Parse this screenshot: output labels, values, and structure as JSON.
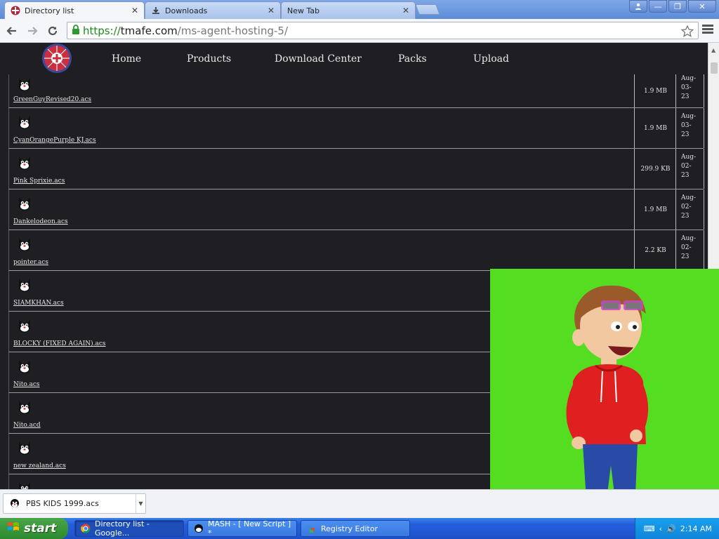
{
  "browser": {
    "tabs": [
      {
        "title": "Directory list",
        "state": "active"
      },
      {
        "title": "Downloads",
        "state": "inactive"
      },
      {
        "title": "New Tab",
        "state": "inactive"
      }
    ],
    "url": {
      "scheme": "https://",
      "host": "tmafe.com",
      "path": "/ms-agent-hosting-5/"
    }
  },
  "site": {
    "nav": [
      {
        "label": "Home"
      },
      {
        "label": "Products"
      },
      {
        "label": "Download Center"
      },
      {
        "label": "Packs"
      },
      {
        "label": "Upload"
      }
    ]
  },
  "files": [
    {
      "name": "GreenGuyRevised20.acs",
      "size": "1.9 MB",
      "date": [
        "Aug-",
        "03-",
        "23"
      ]
    },
    {
      "name": "CyanOrangePurple KJ.acs",
      "size": "1.9 MB",
      "date": [
        "Aug-",
        "03-",
        "23"
      ]
    },
    {
      "name": "Pink Sprixie.acs",
      "size": "299.9 KB",
      "date": [
        "Aug-",
        "02-",
        "23"
      ]
    },
    {
      "name": "Dankelodeon.acs",
      "size": "1.9 MB",
      "date": [
        "Aug-",
        "02-",
        "23"
      ]
    },
    {
      "name": "pointer.acs",
      "size": "2.2 KB",
      "date": [
        "Aug-",
        "02-",
        "23"
      ]
    },
    {
      "name": "SIAMKHAN.acs",
      "size": "",
      "date": [
        "",
        "",
        ""
      ]
    },
    {
      "name": "BLOCKY (FIXED AGAIN).acs",
      "size": "",
      "date": [
        "",
        "",
        ""
      ]
    },
    {
      "name": "Nito.acs",
      "size": "",
      "date": [
        "",
        "",
        ""
      ]
    },
    {
      "name": "Nito.acd",
      "size": "",
      "date": [
        "",
        "",
        ""
      ]
    },
    {
      "name": "new zealand.acs",
      "size": "",
      "date": [
        "",
        "",
        ""
      ]
    }
  ],
  "download_bar": {
    "item": "PBS KIDS 1999.acs"
  },
  "taskbar": {
    "start": "start",
    "tasks": [
      {
        "label": "Directory list - Google..."
      },
      {
        "label": "MASH - [ New Script ] *"
      },
      {
        "label": "Registry Editor"
      }
    ],
    "clock": "2:14 AM"
  },
  "colors": {
    "page_bg": "#1f1f23",
    "agent_chroma": "#55dd22",
    "taskbar": "#245edb",
    "start_button": "#3c9a3c",
    "url_scheme": "#1a8a1a"
  }
}
